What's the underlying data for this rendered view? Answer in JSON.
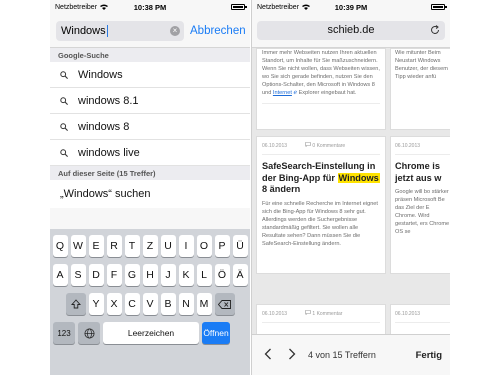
{
  "left": {
    "status": {
      "carrier": "Netzbetreiber",
      "time": "10:38 PM"
    },
    "search": {
      "value": "Windows",
      "cancel_label": "Abbrechen"
    },
    "google_header": "Google-Suche",
    "suggestions": [
      "Windows",
      "windows 8.1",
      "windows 8",
      "windows live"
    ],
    "page_header": "Auf dieser Seite (15 Treffer)",
    "page_find": "„Windows“ suchen",
    "keyboard": {
      "row1": [
        "Q",
        "W",
        "E",
        "R",
        "T",
        "Z",
        "U",
        "I",
        "O",
        "P",
        "Ü"
      ],
      "row2": [
        "A",
        "S",
        "D",
        "F",
        "G",
        "H",
        "J",
        "K",
        "L",
        "Ö",
        "Ä"
      ],
      "row3": [
        "Y",
        "X",
        "C",
        "V",
        "B",
        "N",
        "M"
      ],
      "key_123": "123",
      "space_label": "Leerzeichen",
      "go_label": "Öffnen"
    }
  },
  "right": {
    "status": {
      "carrier": "Netzbetreiber",
      "time": "10:39 PM"
    },
    "url": "schieb.de",
    "card_a": {
      "text_before_link": "Immer mehr Webseiten nutzen Ihren aktuellen Standort, um Inhalte für Sie maßzuschneidern. Wenn Sie nicht wollen, dass Webseiten wissen, wo Sie sich gerade befinden, nutzen Sie den Options-Schalter, den Microsoft in Windows 8 und",
      "link": "Internet",
      "text_after_link": "Explorer eingebaut hat."
    },
    "card_b": {
      "text": "Wie mitunter Beim Neustart Windows Benutzer, der diesem Tipp wieder anfü"
    },
    "card_c": {
      "date": "06.10.2013",
      "comments": "0 Kommentare",
      "title_before": "SafeSearch-Einstellung in der Bing-App für",
      "title_highlight": "Windows",
      "title_after": "8 ändern",
      "body": "Für eine schnelle Recherche im Internet eignet sich die Bing-App für Windows 8 sehr gut. Allerdings werden die Suchergebnisse standardmäßig gefiltert. Sie wollen alle Resultate sehen? Dann müssen Sie die SafeSearch-Einstellung ändern."
    },
    "card_d": {
      "date": "06.10.2013",
      "title": "Chrome is jetzt aus w",
      "body": "Google will bo stärker präsen Microsoft Be das Ziel der E Chrome. Wird gestartet, ers Chrome OS se"
    },
    "card_e": {
      "date": "06.10.2013",
      "comments": "1 Kommentar"
    },
    "card_f": {
      "date": "06.10.2013"
    },
    "find_bar": {
      "count": "4 von 15 Treffern",
      "done_label": "Fertig"
    }
  }
}
